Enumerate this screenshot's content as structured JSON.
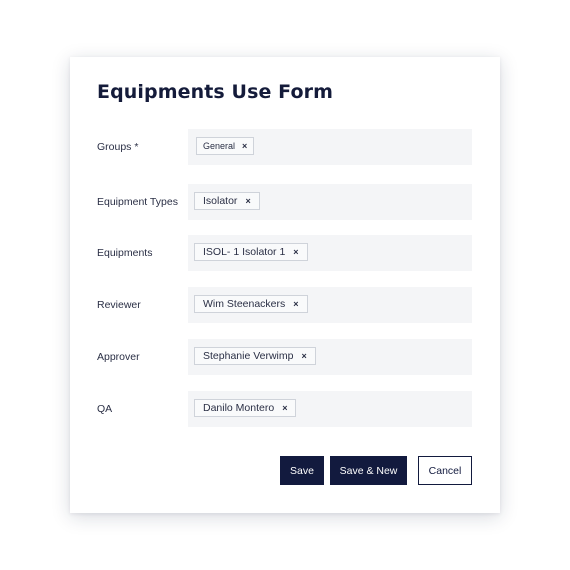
{
  "form": {
    "title": "Equipments Use Form",
    "fields": [
      {
        "label": "Groups *",
        "chips": [
          "General"
        ]
      },
      {
        "label": "Equipment Types",
        "chips": [
          "Isolator"
        ]
      },
      {
        "label": "Equipments",
        "chips": [
          "ISOL- 1 Isolator 1"
        ]
      },
      {
        "label": "Reviewer",
        "chips": [
          "Wim Steenackers"
        ]
      },
      {
        "label": "Approver",
        "chips": [
          "Stephanie Verwimp"
        ]
      },
      {
        "label": "QA",
        "chips": [
          "Danilo Montero"
        ]
      }
    ],
    "chip_remove_glyph": "×",
    "buttons": {
      "save": "Save",
      "save_new": "Save & New",
      "cancel": "Cancel"
    }
  },
  "colors": {
    "primary": "#121a3e",
    "field_background": "#f4f5f7",
    "chip_border": "#cfd3da"
  }
}
